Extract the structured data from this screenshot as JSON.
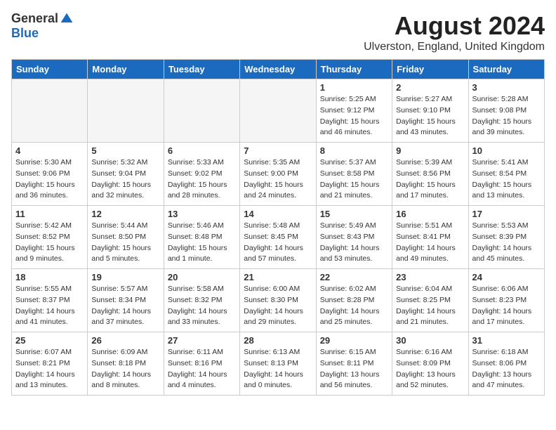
{
  "header": {
    "logo_general": "General",
    "logo_blue": "Blue",
    "month_year": "August 2024",
    "location": "Ulverston, England, United Kingdom"
  },
  "weekdays": [
    "Sunday",
    "Monday",
    "Tuesday",
    "Wednesday",
    "Thursday",
    "Friday",
    "Saturday"
  ],
  "weeks": [
    [
      {
        "day": "",
        "info": ""
      },
      {
        "day": "",
        "info": ""
      },
      {
        "day": "",
        "info": ""
      },
      {
        "day": "",
        "info": ""
      },
      {
        "day": "1",
        "info": "Sunrise: 5:25 AM\nSunset: 9:12 PM\nDaylight: 15 hours\nand 46 minutes."
      },
      {
        "day": "2",
        "info": "Sunrise: 5:27 AM\nSunset: 9:10 PM\nDaylight: 15 hours\nand 43 minutes."
      },
      {
        "day": "3",
        "info": "Sunrise: 5:28 AM\nSunset: 9:08 PM\nDaylight: 15 hours\nand 39 minutes."
      }
    ],
    [
      {
        "day": "4",
        "info": "Sunrise: 5:30 AM\nSunset: 9:06 PM\nDaylight: 15 hours\nand 36 minutes."
      },
      {
        "day": "5",
        "info": "Sunrise: 5:32 AM\nSunset: 9:04 PM\nDaylight: 15 hours\nand 32 minutes."
      },
      {
        "day": "6",
        "info": "Sunrise: 5:33 AM\nSunset: 9:02 PM\nDaylight: 15 hours\nand 28 minutes."
      },
      {
        "day": "7",
        "info": "Sunrise: 5:35 AM\nSunset: 9:00 PM\nDaylight: 15 hours\nand 24 minutes."
      },
      {
        "day": "8",
        "info": "Sunrise: 5:37 AM\nSunset: 8:58 PM\nDaylight: 15 hours\nand 21 minutes."
      },
      {
        "day": "9",
        "info": "Sunrise: 5:39 AM\nSunset: 8:56 PM\nDaylight: 15 hours\nand 17 minutes."
      },
      {
        "day": "10",
        "info": "Sunrise: 5:41 AM\nSunset: 8:54 PM\nDaylight: 15 hours\nand 13 minutes."
      }
    ],
    [
      {
        "day": "11",
        "info": "Sunrise: 5:42 AM\nSunset: 8:52 PM\nDaylight: 15 hours\nand 9 minutes."
      },
      {
        "day": "12",
        "info": "Sunrise: 5:44 AM\nSunset: 8:50 PM\nDaylight: 15 hours\nand 5 minutes."
      },
      {
        "day": "13",
        "info": "Sunrise: 5:46 AM\nSunset: 8:48 PM\nDaylight: 15 hours\nand 1 minute."
      },
      {
        "day": "14",
        "info": "Sunrise: 5:48 AM\nSunset: 8:45 PM\nDaylight: 14 hours\nand 57 minutes."
      },
      {
        "day": "15",
        "info": "Sunrise: 5:49 AM\nSunset: 8:43 PM\nDaylight: 14 hours\nand 53 minutes."
      },
      {
        "day": "16",
        "info": "Sunrise: 5:51 AM\nSunset: 8:41 PM\nDaylight: 14 hours\nand 49 minutes."
      },
      {
        "day": "17",
        "info": "Sunrise: 5:53 AM\nSunset: 8:39 PM\nDaylight: 14 hours\nand 45 minutes."
      }
    ],
    [
      {
        "day": "18",
        "info": "Sunrise: 5:55 AM\nSunset: 8:37 PM\nDaylight: 14 hours\nand 41 minutes."
      },
      {
        "day": "19",
        "info": "Sunrise: 5:57 AM\nSunset: 8:34 PM\nDaylight: 14 hours\nand 37 minutes."
      },
      {
        "day": "20",
        "info": "Sunrise: 5:58 AM\nSunset: 8:32 PM\nDaylight: 14 hours\nand 33 minutes."
      },
      {
        "day": "21",
        "info": "Sunrise: 6:00 AM\nSunset: 8:30 PM\nDaylight: 14 hours\nand 29 minutes."
      },
      {
        "day": "22",
        "info": "Sunrise: 6:02 AM\nSunset: 8:28 PM\nDaylight: 14 hours\nand 25 minutes."
      },
      {
        "day": "23",
        "info": "Sunrise: 6:04 AM\nSunset: 8:25 PM\nDaylight: 14 hours\nand 21 minutes."
      },
      {
        "day": "24",
        "info": "Sunrise: 6:06 AM\nSunset: 8:23 PM\nDaylight: 14 hours\nand 17 minutes."
      }
    ],
    [
      {
        "day": "25",
        "info": "Sunrise: 6:07 AM\nSunset: 8:21 PM\nDaylight: 14 hours\nand 13 minutes."
      },
      {
        "day": "26",
        "info": "Sunrise: 6:09 AM\nSunset: 8:18 PM\nDaylight: 14 hours\nand 8 minutes."
      },
      {
        "day": "27",
        "info": "Sunrise: 6:11 AM\nSunset: 8:16 PM\nDaylight: 14 hours\nand 4 minutes."
      },
      {
        "day": "28",
        "info": "Sunrise: 6:13 AM\nSunset: 8:13 PM\nDaylight: 14 hours\nand 0 minutes."
      },
      {
        "day": "29",
        "info": "Sunrise: 6:15 AM\nSunset: 8:11 PM\nDaylight: 13 hours\nand 56 minutes."
      },
      {
        "day": "30",
        "info": "Sunrise: 6:16 AM\nSunset: 8:09 PM\nDaylight: 13 hours\nand 52 minutes."
      },
      {
        "day": "31",
        "info": "Sunrise: 6:18 AM\nSunset: 8:06 PM\nDaylight: 13 hours\nand 47 minutes."
      }
    ]
  ]
}
